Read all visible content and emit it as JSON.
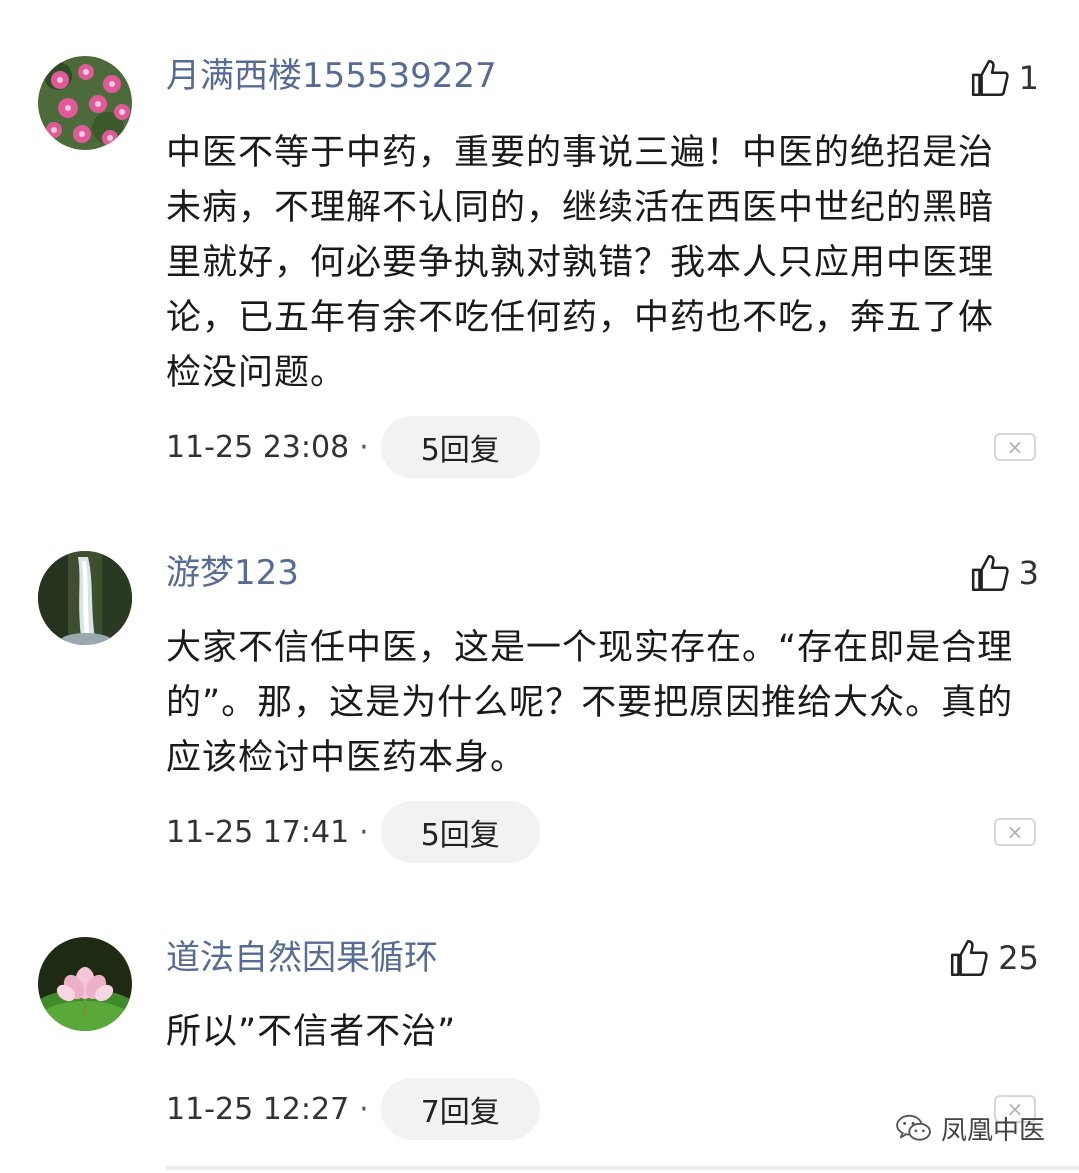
{
  "comments": [
    {
      "username": "月满西楼155539227",
      "avatar_icon": "pink-flower-avatar",
      "likes": "1",
      "text": "中医不等于中药，重要的事说三遍！中医的绝招是治未病，不理解不认同的，继续活在西医中世纪的黑暗里就好，何必要争执孰对孰错？我本人只应用中医理论，已五年有余不吃任何药，中药也不吃，奔五了体检没问题。",
      "time": "11-25 23:08",
      "replies": "5回复"
    },
    {
      "username": "游梦123",
      "avatar_icon": "waterfall-avatar",
      "likes": "3",
      "text": "大家不信任中医，这是一个现实存在。“存在即是合理的”。那，这是为什么呢？不要把原因推给大众。真的应该检讨中医药本身。",
      "time": "11-25 17:41",
      "replies": "5回复"
    },
    {
      "username": "道法自然因果循环",
      "avatar_icon": "lotus-avatar",
      "likes": "25",
      "text": "所以”不信者不治”",
      "time": "11-25 12:27",
      "replies": "7回复"
    }
  ],
  "separator": "·",
  "close_symbol": "×",
  "watermark": {
    "icon": "wechat-icon",
    "text": "凤凰中医"
  },
  "colors": {
    "username": "#576b95",
    "text": "#1a1a1a",
    "reply_bg": "#f2f2f2"
  }
}
